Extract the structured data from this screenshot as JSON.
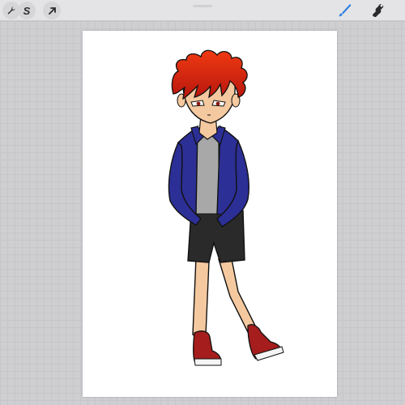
{
  "app": {
    "toolbar": {
      "left_tools": [
        {
          "icon": "wrench-icon",
          "label": ""
        },
        {
          "icon": "selection-s-icon",
          "label": "S"
        },
        {
          "icon": "transform-arrow-icon",
          "label": ""
        }
      ],
      "right_tools": [
        {
          "icon": "brush-icon"
        },
        {
          "icon": "smudge-icon"
        }
      ],
      "accent_color": "#2f7fe0"
    }
  },
  "canvas": {
    "background": "#ffffff",
    "artwork": "character-drawing"
  },
  "colors": {
    "hair": "#e22b0f",
    "skin": "#f5c9a0",
    "jacket": "#2c2f95",
    "shirt": "#a8a8a8",
    "shorts": "#2a2a2a",
    "shoes": "#a51d1d"
  }
}
